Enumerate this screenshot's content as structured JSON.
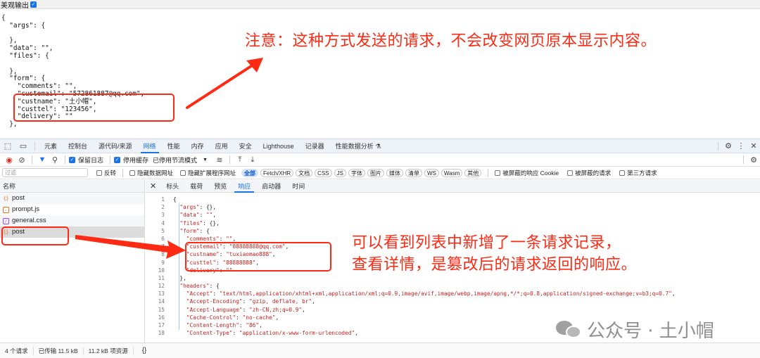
{
  "page": {
    "pretty_print_label": "美观输出",
    "pretty_print_checked": true,
    "raw_json_lines": [
      "{",
      "  \"args\": {",
      "",
      "  },",
      "  \"data\": \"\",",
      "  \"files\": {",
      "",
      "  },",
      "  \"form\": {",
      "    \"comments\": \"\",",
      "    \"custemail\": \"572861887@qq.com\",",
      "    \"custname\": \"土小帽\",",
      "    \"custtel\": \"123456\",",
      "    \"delivery\": \"\"",
      "  },"
    ]
  },
  "annotations": {
    "note_top": "注意：这种方式发送的请求，不会改变网页原本显示内容。",
    "note_bottom_line1": "可以看到列表中新增了一条请求记录，",
    "note_bottom_line2": "查看详情，是篡改后的请求返回的响应。",
    "accent_color": "#ff2a14"
  },
  "devtools": {
    "tabs": [
      {
        "label": "元素",
        "active": false
      },
      {
        "label": "控制台",
        "active": false
      },
      {
        "label": "源代码/来源",
        "active": false
      },
      {
        "label": "网络",
        "active": true
      },
      {
        "label": "性能",
        "active": false
      },
      {
        "label": "内存",
        "active": false
      },
      {
        "label": "应用",
        "active": false
      },
      {
        "label": "安全",
        "active": false
      },
      {
        "label": "Lighthouse",
        "active": false
      },
      {
        "label": "记录器",
        "active": false
      },
      {
        "label": "性能数据分析 ⚗",
        "active": false
      }
    ],
    "toolbar": {
      "preserve_log_label": "保留日志",
      "preserve_log_checked": true,
      "disable_cache_label": "停用缓存",
      "disable_cache_checked": true,
      "throttle_value": "已停用节流模式"
    },
    "filter": {
      "placeholder": "过滤",
      "invert_label": "反转",
      "hide_data_urls_label": "隐藏数据网址",
      "hide_ext_urls_label": "隐藏扩展程序网址",
      "types": [
        "全部",
        "Fetch/XHR",
        "文档",
        "CSS",
        "JS",
        "字体",
        "图片",
        "媒体",
        "清单",
        "WS",
        "Wasm",
        "其他"
      ],
      "active_type": "全部",
      "blocked_cookies_label": "被屏蔽的响应 Cookie",
      "blocked_requests_label": "被屏蔽的请求",
      "third_party_label": "第三方请求"
    },
    "request_list": {
      "header": "名称",
      "rows": [
        {
          "name": "post",
          "type": "xhr",
          "selected": false
        },
        {
          "name": "prompt.js",
          "type": "js",
          "selected": false
        },
        {
          "name": "general.css",
          "type": "css",
          "selected": false
        },
        {
          "name": "post",
          "type": "xhr",
          "selected": true
        }
      ]
    },
    "detail_tabs": [
      {
        "label": "标头",
        "active": false
      },
      {
        "label": "载荷",
        "active": false
      },
      {
        "label": "预览",
        "active": false
      },
      {
        "label": "响应",
        "active": true
      },
      {
        "label": "启动器",
        "active": false
      },
      {
        "label": "时间",
        "active": false
      }
    ],
    "response_lines": [
      {
        "n": "1",
        "text": "{"
      },
      {
        "n": "2",
        "text": "  \"args\": {},"
      },
      {
        "n": "3",
        "text": "  \"data\": \"\","
      },
      {
        "n": "4",
        "text": "  \"files\": {},"
      },
      {
        "n": "5",
        "text": "  \"form\": {"
      },
      {
        "n": "6",
        "text": "    \"comments\": \"\","
      },
      {
        "n": "7",
        "text": "    \"custemail\": \"88888888@qq.com\","
      },
      {
        "n": "8",
        "text": "    \"custname\": \"tuxiaomao888\","
      },
      {
        "n": "9",
        "text": "    \"custtel\": \"88888888\","
      },
      {
        "n": "10",
        "text": "    \"delivery\": \"\""
      },
      {
        "n": "11",
        "text": "  },"
      },
      {
        "n": "12",
        "text": "  \"headers\": {"
      },
      {
        "n": "13",
        "text": "    \"Accept\": \"text/html,application/xhtml+xml,application/xml;q=0.9,image/avif,image/webp,image/apng,*/*;q=0.8,application/signed-exchange;v=b3;q=0.7\","
      },
      {
        "n": "14",
        "text": "    \"Accept-Encoding\": \"gzip, deflate, br\","
      },
      {
        "n": "15",
        "text": "    \"Accept-Language\": \"zh-CN,zh;q=0.9\","
      },
      {
        "n": "16",
        "text": "    \"Cache-Control\": \"no-cache\","
      },
      {
        "n": "17",
        "text": "    \"Content-Length\": \"86\","
      },
      {
        "n": "18",
        "text": "    \"Content-Type\": \"application/x-www-form-urlencoded\","
      }
    ],
    "status": {
      "requests": "4 个请求",
      "transferred": "已传输 11.5 kB",
      "resources": "11.2 kB 项资源",
      "format_icon": "{}"
    }
  },
  "watermark": {
    "text": "公众号 · 土小帽",
    "icon": "wechat-icon"
  }
}
